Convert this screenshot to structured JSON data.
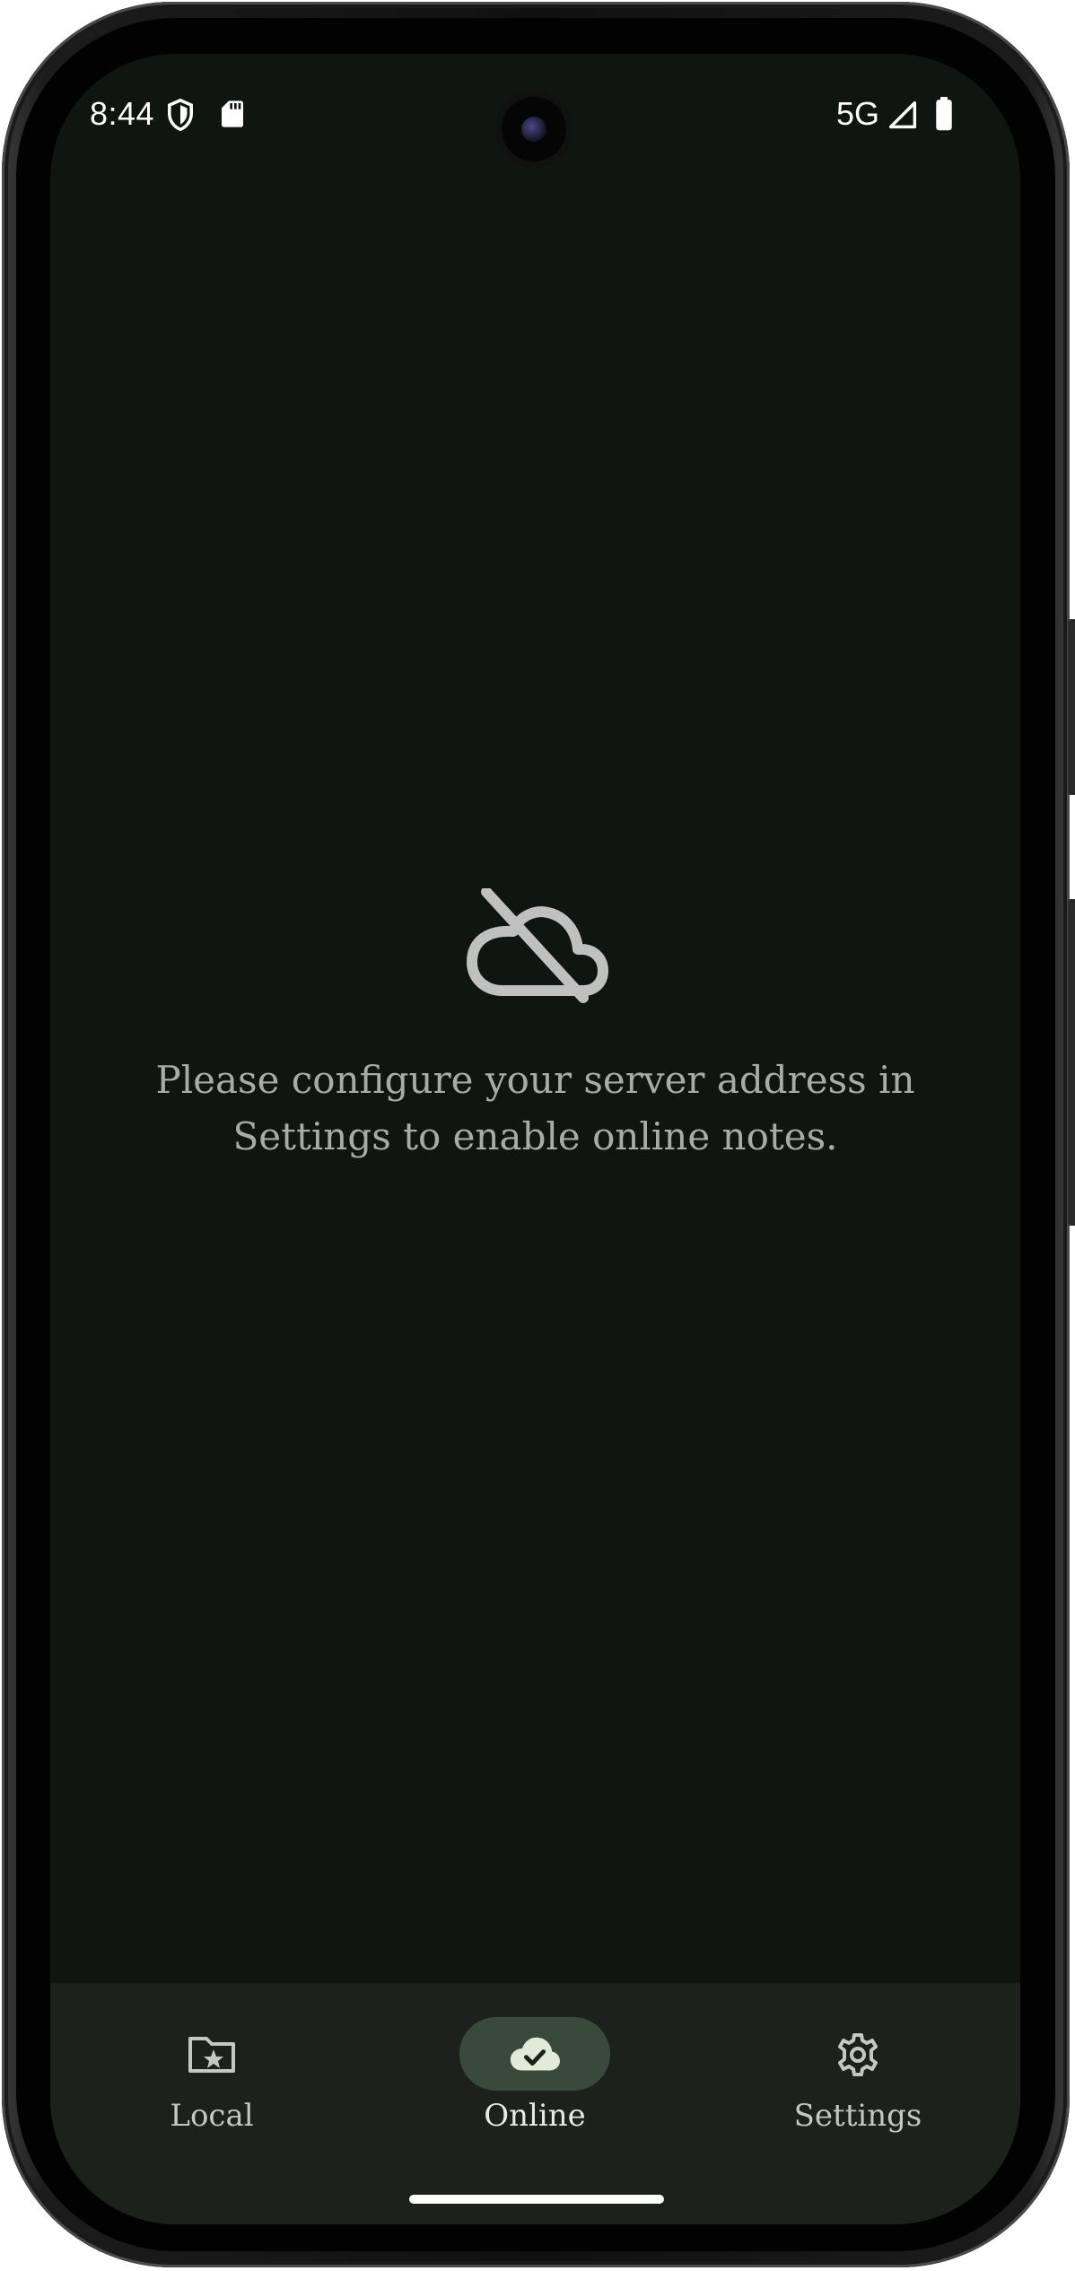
{
  "status_bar": {
    "time": "8:44",
    "network": "5G",
    "shield_icon": "shield-icon",
    "sd_icon": "sd-card-icon",
    "signal_icon": "signal-icon",
    "battery_icon": "battery-icon"
  },
  "empty_state": {
    "icon": "cloud-off-icon",
    "message": "Please configure your server address in Settings to enable online notes."
  },
  "bottom_nav": {
    "items": [
      {
        "label": "Local",
        "icon": "folder-star-icon",
        "active": false
      },
      {
        "label": "Online",
        "icon": "cloud-check-icon",
        "active": true
      },
      {
        "label": "Settings",
        "icon": "gear-icon",
        "active": false
      }
    ]
  },
  "colors": {
    "background": "#0f1510",
    "nav_background": "#1c211c",
    "active_pill": "#3a4a3a",
    "message_text": "#a8aca6",
    "icon_gray": "#c0c0c0"
  }
}
